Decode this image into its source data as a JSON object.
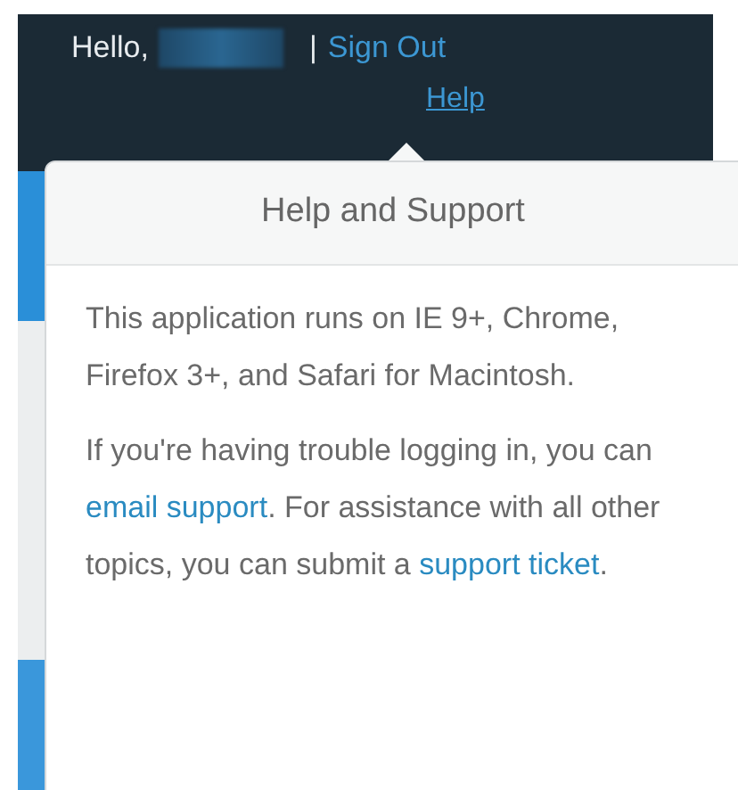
{
  "header": {
    "greeting": "Hello,",
    "separator": "|",
    "sign_out": "Sign Out",
    "help": "Help"
  },
  "popover": {
    "title": "Help and Support",
    "paragraphs": [
      [
        {
          "kind": "text",
          "text": "This application runs on IE 9+, Chrome, Firefox 3+, and Safari for Macintosh."
        }
      ],
      [
        {
          "kind": "text",
          "text": "If you're having trouble logging in, you can "
        },
        {
          "kind": "link",
          "text": "email support"
        },
        {
          "kind": "text",
          "text": ". For assistance with all other topics, you can submit a "
        },
        {
          "kind": "link",
          "text": "support ticket"
        },
        {
          "kind": "text",
          "text": "."
        }
      ]
    ]
  }
}
